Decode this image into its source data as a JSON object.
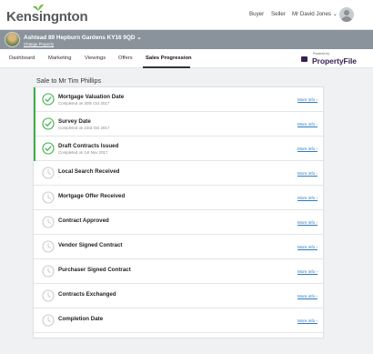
{
  "header": {
    "logo_text_left": "Kensi",
    "logo_text_g": "g",
    "logo_text_right": "nton",
    "logo_text_n": "n",
    "nav": {
      "buyer": "Buyer",
      "seller": "Seller",
      "user": "Mr David Jones ⌄"
    }
  },
  "property": {
    "address": "Ashtead 89 Hepburn Gardens KY16 9QD ⌄",
    "change_label": "Change Property"
  },
  "tabs": [
    {
      "label": "Dashboard",
      "active": false
    },
    {
      "label": "Marketing",
      "active": false
    },
    {
      "label": "Viewings",
      "active": false
    },
    {
      "label": "Offers",
      "active": false
    },
    {
      "label": "Sales Progression",
      "active": true
    }
  ],
  "propertyfile": {
    "powered_by": "Powered by",
    "name": "PropertyFile"
  },
  "sale": {
    "title": "Sale to Mr Tim Phillips",
    "steps": [
      {
        "title": "Mortgage Valuation Date",
        "sub": "Completed on 30th Oct 2017",
        "done": true,
        "more": "More info ›"
      },
      {
        "title": "Survey Date",
        "sub": "Completed on 23rd Oct 2017",
        "done": true,
        "more": "More info ›"
      },
      {
        "title": "Draft Contracts Issued",
        "sub": "Completed on 1st Nov 2017",
        "done": true,
        "more": "More info ›"
      },
      {
        "title": "Local Search Received",
        "sub": "-",
        "done": false,
        "more": "More info ›"
      },
      {
        "title": "Mortgage Offer Received",
        "sub": "",
        "done": false,
        "more": "More info ›"
      },
      {
        "title": "Contract Approved",
        "sub": "",
        "done": false,
        "more": "More info ›"
      },
      {
        "title": "Vendor Signed Contract",
        "sub": "",
        "done": false,
        "more": "More info ›"
      },
      {
        "title": "Purchaser Signed Contract",
        "sub": "",
        "done": false,
        "more": "More info ›"
      },
      {
        "title": "Contracts Exchanged",
        "sub": "",
        "done": false,
        "more": "More info ›"
      },
      {
        "title": "Completion Date",
        "sub": "",
        "done": false,
        "more": "More info ›"
      }
    ]
  },
  "icons": {
    "check": "check-circle-icon",
    "pending": "clock-icon"
  },
  "colors": {
    "done": "#3fae49",
    "pending": "#c7cbcf",
    "link": "#2b7bc1",
    "propbar": "#8a939c",
    "propertyfile": "#3a1f4f"
  }
}
